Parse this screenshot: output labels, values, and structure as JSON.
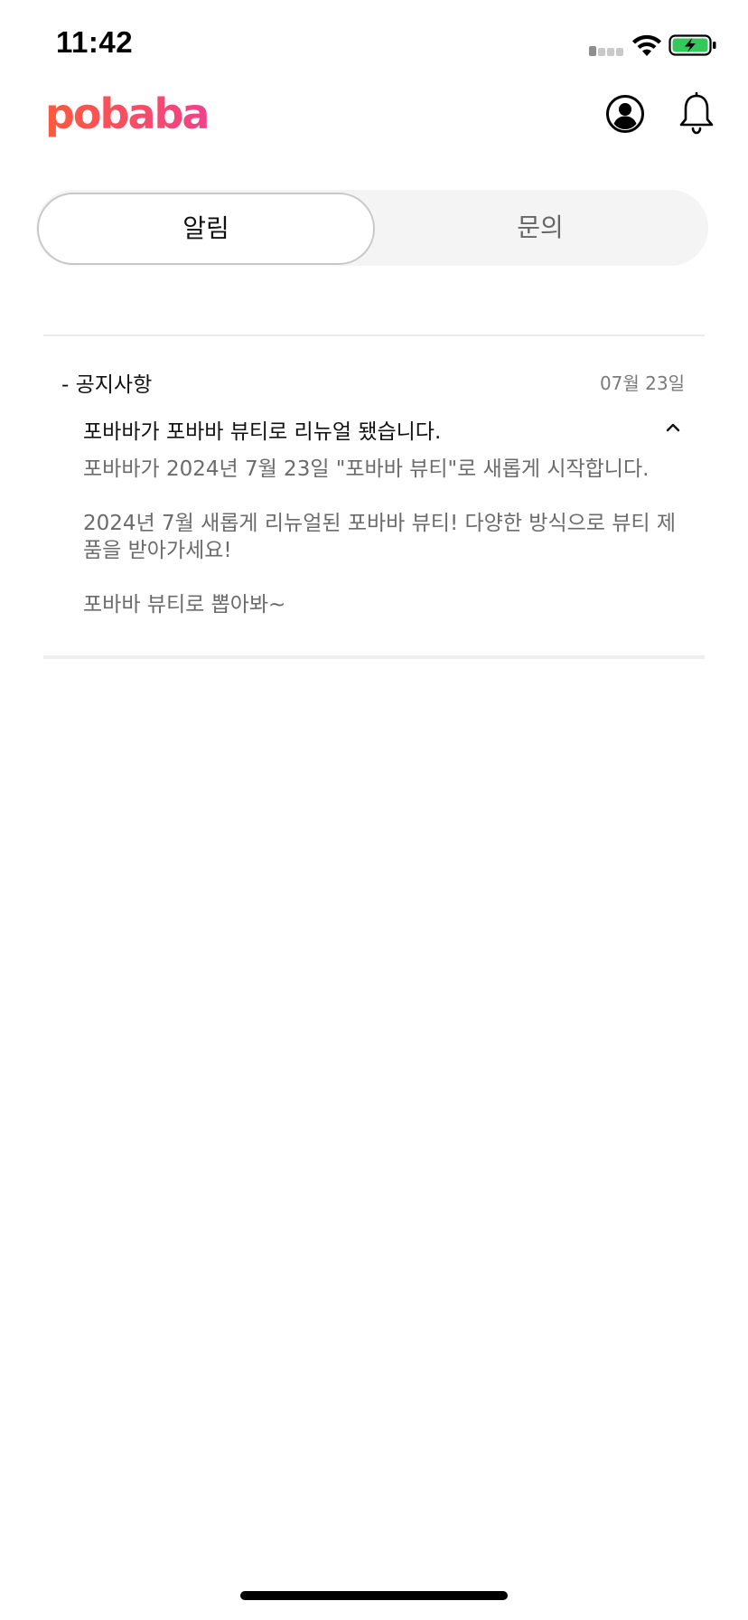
{
  "status_bar": {
    "time": "11:42"
  },
  "header": {
    "logo_text": "pobaba",
    "profile_icon": "user-circle-icon",
    "bell_icon": "bell-icon"
  },
  "tabs": [
    {
      "label": "알림",
      "selected": true
    },
    {
      "label": "문의",
      "selected": false
    }
  ],
  "notices": [
    {
      "category": "- 공지사항",
      "date": "07월 23일",
      "title": "포바바가 포바바 뷰티로 리뉴얼 됐습니다.",
      "expanded": true,
      "body": [
        "포바바가 2024년 7월 23일 \"포바바 뷰티\"로 새롭게 시작합니다.",
        "2024년 7월 새롭게 리뉴얼된 포바바 뷰티! 다양한 방식으로 뷰티 제품을 받아가세요!",
        "포바바 뷰티로 뽑아봐~"
      ]
    }
  ],
  "colors": {
    "logo_start": "#ff5a3c",
    "logo_end": "#f0428a",
    "battery_fill": "#34c759",
    "tab_background": "#f4f4f4",
    "divider": "#ececec"
  }
}
